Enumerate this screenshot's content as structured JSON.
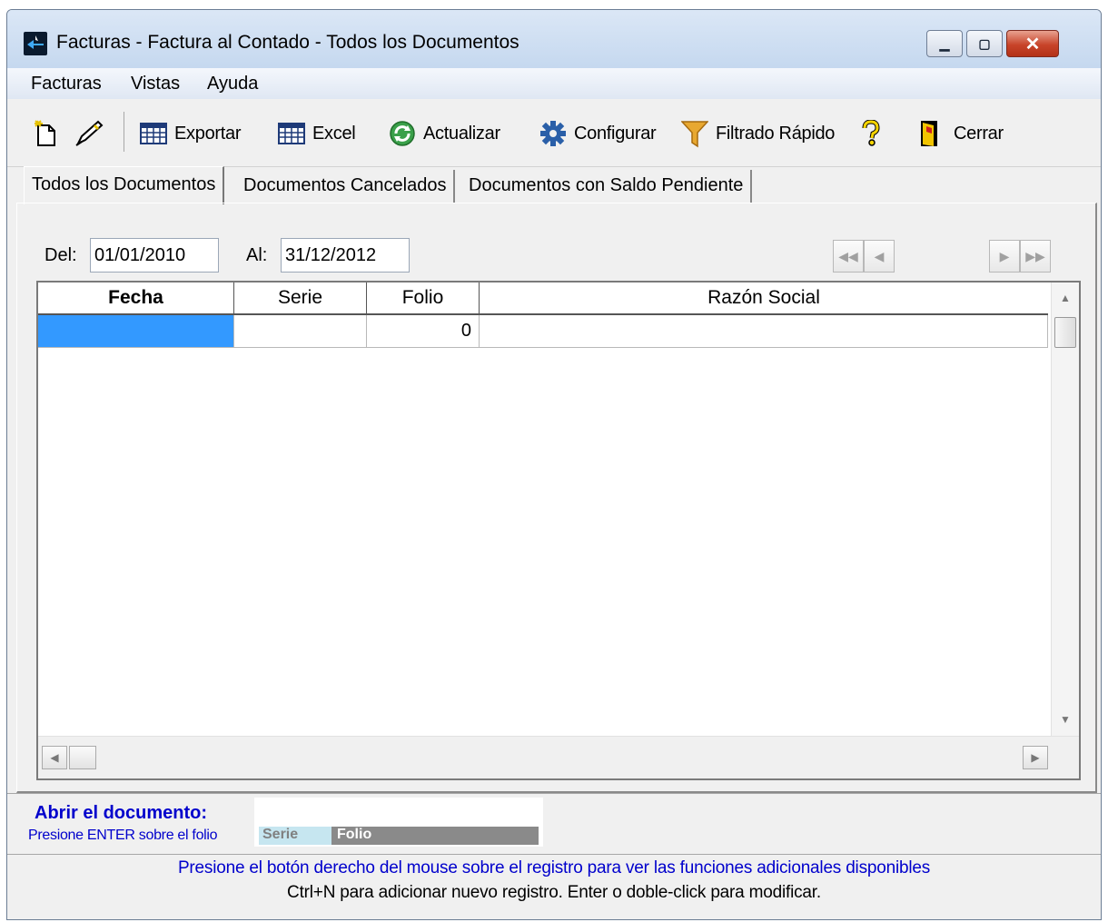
{
  "window": {
    "title": "Facturas - Factura al Contado - Todos los Documentos"
  },
  "menu": [
    "Facturas",
    "Vistas",
    "Ayuda"
  ],
  "toolbar": {
    "exportar": "Exportar",
    "excel": "Excel",
    "actualizar": "Actualizar",
    "configurar": "Configurar",
    "filtrado": "Filtrado Rápido",
    "cerrar": "Cerrar"
  },
  "tabs": [
    "Todos los Documentos",
    "Documentos Cancelados",
    "Documentos con Saldo Pendiente"
  ],
  "filter": {
    "del_label": "Del:",
    "del_value": "01/01/2010",
    "al_label": "Al:",
    "al_value": "31/12/2012"
  },
  "grid": {
    "columns": [
      "Fecha",
      "Serie",
      "Folio",
      "Razón Social"
    ],
    "rows": [
      {
        "fecha": "",
        "serie": "",
        "folio": "0",
        "razon": ""
      }
    ]
  },
  "bottom": {
    "abrir_title": "Abrir el documento:",
    "abrir_sub": "Presione ENTER sobre el folio",
    "serie_label": "Serie",
    "folio_label": "Folio",
    "hint1": "Presione el botón derecho del mouse sobre el registro para ver las funciones adicionales disponibles",
    "hint2": "Ctrl+N para adicionar nuevo registro. Enter o doble-click para modificar."
  },
  "colors": {
    "selection": "#3399ff",
    "link_blue": "#0000cc",
    "close_red": "#c8442a"
  }
}
